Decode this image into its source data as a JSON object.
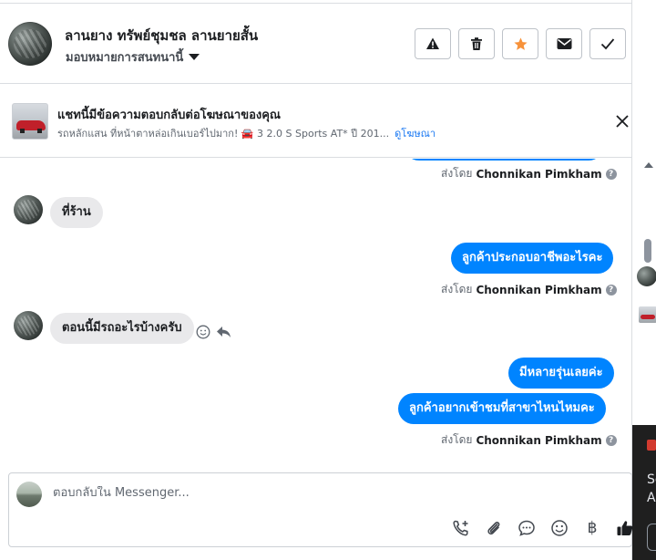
{
  "header": {
    "contact_name": "ลานยาง ทรัพย์ชุมชล ลานยายสั้น",
    "assign_label": "มอบหมายการสนทนานี้",
    "actions": [
      {
        "name": "report-button",
        "icon": "warning-icon"
      },
      {
        "name": "delete-button",
        "icon": "trash-icon"
      },
      {
        "name": "star-button",
        "icon": "star-icon"
      },
      {
        "name": "mark-unread-button",
        "icon": "envelope-icon"
      },
      {
        "name": "mark-done-button",
        "icon": "check-icon"
      }
    ]
  },
  "ad_banner": {
    "title": "แชทนี้มีข้อความตอบกลับต่อโฆษณาของคุณ",
    "description": "รถหลักแสน ที่หน้าตาหล่อเกินเบอร์ไปมาก! 🚘 3 2.0 S Sports AT* ปี 201...",
    "link_label": "ดูโฆษณา"
  },
  "messages": [
    {
      "type": "sentby",
      "prefix": "ส่งโดย",
      "sender": "Chonnikan Pimkham"
    },
    {
      "type": "in",
      "text": "ที่ร้าน"
    },
    {
      "type": "out",
      "text": "ลูกค้าประกอบอาชีพอะไรคะ"
    },
    {
      "type": "sentby",
      "prefix": "ส่งโดย",
      "sender": "Chonnikan Pimkham"
    },
    {
      "type": "in",
      "text": "ตอนนี้มีรถอะไรบ้างครับ"
    },
    {
      "type": "out",
      "text": "มีหลายรุ่นเลยค่ะ"
    },
    {
      "type": "out",
      "text": "ลูกค้าอยากเข้าชมที่สาขาไหนไหมคะ"
    },
    {
      "type": "sentby",
      "prefix": "ส่งโดย",
      "sender": "Chonnikan Pimkham"
    }
  ],
  "composer": {
    "placeholder": "ตอบกลับใน Messenger...",
    "tools": [
      "call-plus-icon",
      "paperclip-icon",
      "chat-bubble-icon",
      "emoji-icon",
      "baht-icon",
      "thumbs-up-icon"
    ],
    "baht_symbol": "฿"
  },
  "side_panel": {
    "text_lines": [
      "Se",
      "A"
    ]
  },
  "colors": {
    "accent": "#0084ff",
    "star": "#f7923a",
    "link": "#1877f2"
  }
}
